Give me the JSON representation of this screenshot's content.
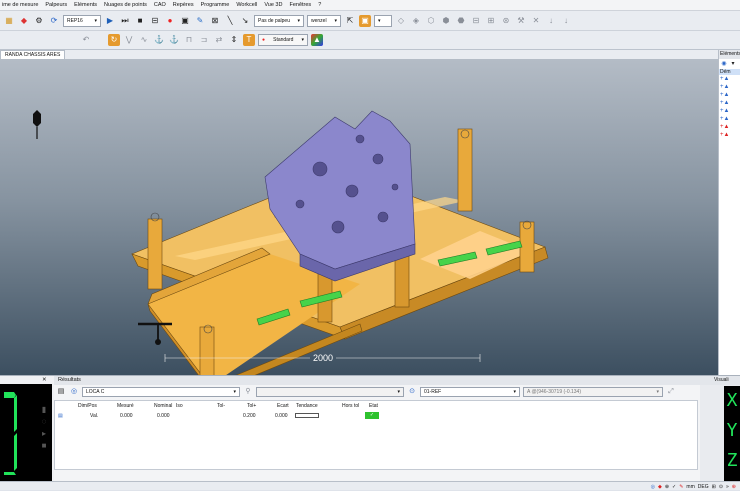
{
  "menu": [
    "ime de mesure",
    "Palpeurs",
    "Eléments",
    "Nuages de points",
    "CAO",
    "Repères",
    "Programme",
    "Workcell",
    "Vue 3D",
    "Fenêtres",
    "?"
  ],
  "toolbar": {
    "rep_select": "REP16",
    "palpeur_select": "Pas de palpeu",
    "wenzel_select": "wenzel",
    "mode_select": "Standard"
  },
  "document_tab": "RANDA CHASSIS ARES",
  "viewport": {
    "dimension_label": "2000"
  },
  "right_panel": {
    "header": "Eléments",
    "tree_label": "Dém"
  },
  "results": {
    "title": "Résultats",
    "loca_select": "LOCA C",
    "ref_value": "01-REF",
    "coords": "A @(946-30719 (-0.134)",
    "columns": [
      "Dim/Pos",
      "Mesuré",
      "Nominal",
      "Iso",
      "Tol-",
      "Tol+",
      "Ecart",
      "Tendance",
      "Hors tol",
      "Etat"
    ],
    "rows": [
      {
        "dimpos": "Val.",
        "mesure": "0.000",
        "nominal": "0.000",
        "iso": "",
        "tolm": "",
        "tolp": "0.200",
        "ecart": "0.000",
        "tendance": "",
        "horstol": "",
        "etat": "✓"
      }
    ]
  },
  "visual_panel": {
    "title": "Visuali",
    "axes": [
      "X",
      "Y",
      "Z"
    ]
  },
  "status": {
    "unit": "mm",
    "angle": "DEG"
  },
  "colors": {
    "fixture": "#f2b545",
    "part": "#8b87cc",
    "pad": "#47d34a",
    "viewport_bottom": "#3c4f60"
  }
}
